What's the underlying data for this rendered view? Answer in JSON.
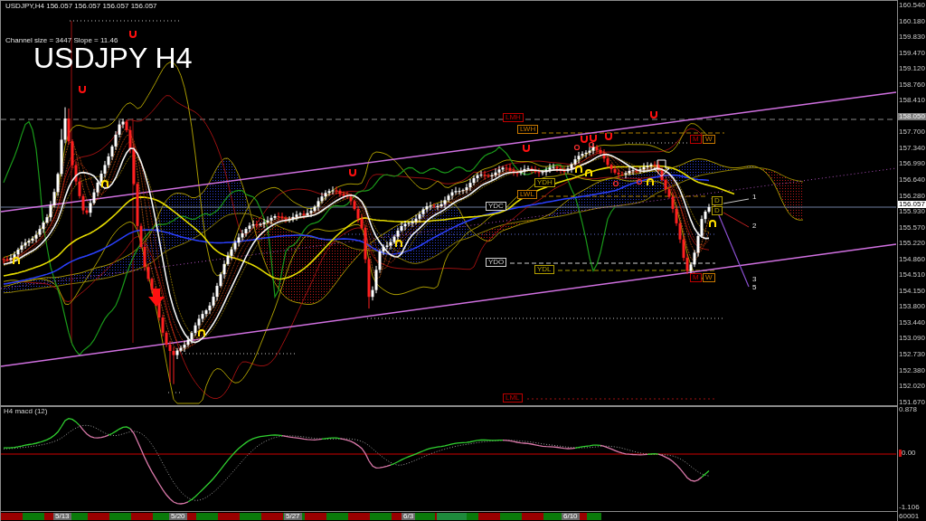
{
  "header": "USDJPY,H4 156.057 156.057 156.057 156.057",
  "channel_info": "Channel size = 3447 Slope = 11.46",
  "title": "USDJPY H4",
  "level_labels": [
    {
      "text": "LMH",
      "color": "#c00000"
    },
    {
      "text": "LWH",
      "color": "#c87800"
    },
    {
      "text": "M",
      "color": "#c00000"
    },
    {
      "text": "W",
      "color": "#c87800"
    },
    {
      "text": "YDH",
      "color": "#b4a000"
    },
    {
      "text": "LWL",
      "color": "#c87800"
    },
    {
      "text": "YDC",
      "color": "#d0d0d0"
    },
    {
      "text": "D",
      "color": "#b4a000"
    },
    {
      "text": "D",
      "color": "#b4a000"
    },
    {
      "text": "YDO",
      "color": "#d0d0d0"
    },
    {
      "text": "YDL",
      "color": "#b4a000"
    },
    {
      "text": "M",
      "color": "#c00000"
    },
    {
      "text": "W",
      "color": "#c87800"
    },
    {
      "text": "LML",
      "color": "#c00000"
    }
  ],
  "wave_labels": [
    "1",
    "2",
    "3",
    "5"
  ],
  "price_axis": {
    "ticks": [
      {
        "label": "160.540",
        "highlighted": false
      },
      {
        "label": "160.180",
        "highlighted": false
      },
      {
        "label": "159.830",
        "highlighted": false
      },
      {
        "label": "159.470",
        "highlighted": false
      },
      {
        "label": "159.120",
        "highlighted": false
      },
      {
        "label": "158.760",
        "highlighted": false
      },
      {
        "label": "158.410",
        "highlighted": false
      },
      {
        "label": "158.050",
        "highlighted": true
      },
      {
        "label": "157.700",
        "highlighted": false
      },
      {
        "label": "157.340",
        "highlighted": false
      },
      {
        "label": "156.990",
        "highlighted": false
      },
      {
        "label": "156.640",
        "highlighted": false
      },
      {
        "label": "156.280",
        "highlighted": false
      },
      {
        "label": "155.930",
        "highlighted": false
      },
      {
        "label": "155.570",
        "highlighted": false
      },
      {
        "label": "155.220",
        "highlighted": false
      },
      {
        "label": "154.860",
        "highlighted": false
      },
      {
        "label": "154.510",
        "highlighted": false
      },
      {
        "label": "154.150",
        "highlighted": false
      },
      {
        "label": "153.800",
        "highlighted": false
      },
      {
        "label": "153.440",
        "highlighted": false
      },
      {
        "label": "153.090",
        "highlighted": false
      },
      {
        "label": "152.730",
        "highlighted": false
      },
      {
        "label": "152.380",
        "highlighted": false
      },
      {
        "label": "152.020",
        "highlighted": false
      },
      {
        "label": "151.670",
        "highlighted": false
      }
    ],
    "current_price": "156.057"
  },
  "macd": {
    "title": "H4 macd (12)",
    "scale": [
      "0.878",
      "0.00",
      "-1.106"
    ]
  },
  "time_axis": {
    "dates": [
      "5/13",
      "5/20",
      "5/27",
      "6/3",
      "6/10"
    ],
    "corner_label": "60001"
  }
}
